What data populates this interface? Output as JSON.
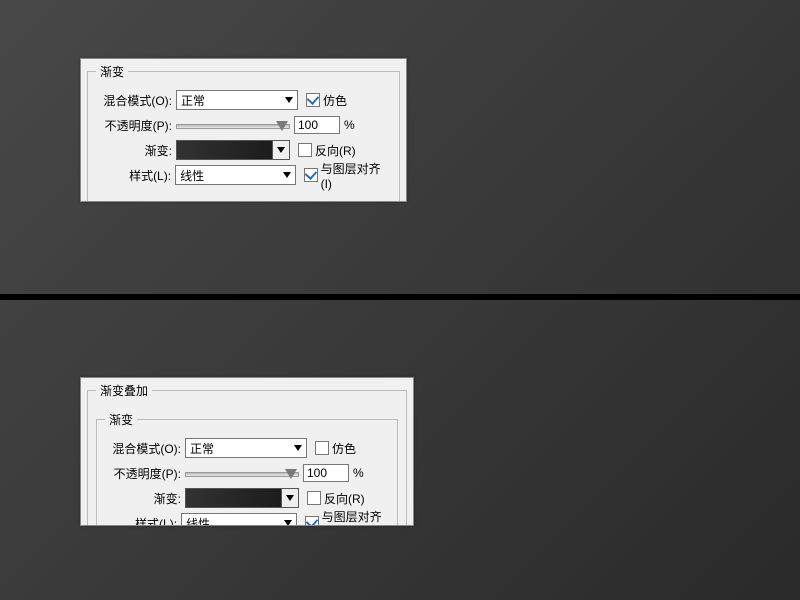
{
  "top": {
    "legend": "渐变",
    "blend_label": "混合模式(O):",
    "blend_value": "正常",
    "dither_label": "仿色",
    "dither_checked": true,
    "opacity_label": "不透明度(P):",
    "opacity_value": "100",
    "opacity_unit": "%",
    "gradient_label": "渐变:",
    "reverse_label": "反向(R)",
    "reverse_checked": false,
    "style_label": "样式(L):",
    "style_value": "线性",
    "align_label": "与图层对齐(I)",
    "align_checked": true
  },
  "bottom": {
    "outer_legend": "渐变叠加",
    "legend": "渐变",
    "blend_label": "混合模式(O):",
    "blend_value": "正常",
    "dither_label": "仿色",
    "dither_checked": false,
    "opacity_label": "不透明度(P):",
    "opacity_value": "100",
    "opacity_unit": "%",
    "gradient_label": "渐变:",
    "reverse_label": "反向(R)",
    "reverse_checked": false,
    "style_label": "样式(L):",
    "style_value": "线性",
    "align_label": "与图层对齐(I)",
    "align_checked": true
  }
}
